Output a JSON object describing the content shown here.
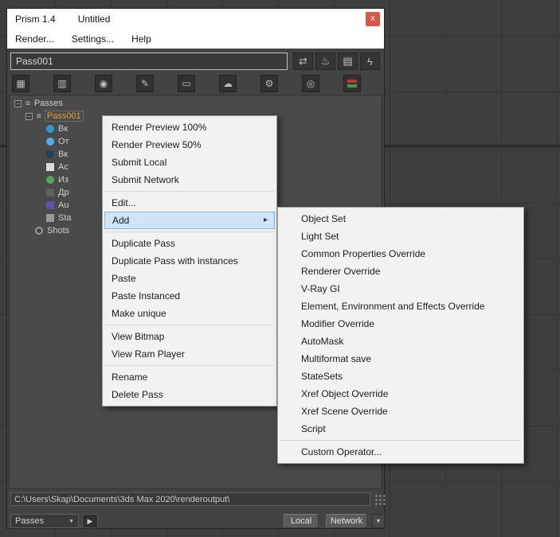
{
  "window": {
    "title": "Prism 1.4",
    "document": "Untitled",
    "close_glyph": "x"
  },
  "menubar": {
    "items": [
      {
        "label": "Render..."
      },
      {
        "label": "Settings..."
      },
      {
        "label": "Help"
      }
    ]
  },
  "pass_field": {
    "value": "Pass001"
  },
  "pass_toolbar": [
    {
      "name": "export-icon",
      "glyph": "⇄"
    },
    {
      "name": "render-teapot-icon",
      "glyph": "♨"
    },
    {
      "name": "render-elements-icon",
      "glyph": "▤"
    },
    {
      "name": "quick-render-icon",
      "glyph": "ϟ"
    }
  ],
  "main_toolbar": [
    {
      "name": "grid-icon",
      "glyph": "▦"
    },
    {
      "name": "display-icon",
      "glyph": "▥"
    },
    {
      "name": "record-icon",
      "glyph": "◉"
    },
    {
      "name": "brush-icon",
      "glyph": "✎"
    },
    {
      "name": "monitor-icon",
      "glyph": "▭"
    },
    {
      "name": "cloud-icon",
      "glyph": "☁"
    },
    {
      "name": "settings-icon",
      "glyph": "⚙"
    },
    {
      "name": "camera-icon",
      "glyph": "◎"
    },
    {
      "name": "colors-icon",
      "glyph": ""
    }
  ],
  "tree": {
    "expander_glyph": "−",
    "root": {
      "label": "Passes",
      "icon_glyph": "≡"
    },
    "selected_pass": {
      "label": "Pass001",
      "icon_glyph": "≡"
    },
    "children": [
      {
        "label": "Вк"
      },
      {
        "label": "От"
      },
      {
        "label": "Вк"
      },
      {
        "label": "Ac"
      },
      {
        "label": "Из"
      },
      {
        "label": "Др"
      },
      {
        "label": "Au"
      },
      {
        "label": "Sta"
      }
    ],
    "shots": {
      "label": "Shots"
    }
  },
  "context_menu": {
    "submenu_arrow": "▸",
    "items": [
      {
        "label": "Render Preview 100%"
      },
      {
        "label": "Render Preview 50%"
      },
      {
        "label": "Submit Local"
      },
      {
        "label": "Submit Network"
      },
      {
        "label": "Edit..."
      },
      {
        "label": "Add"
      },
      {
        "label": "Duplicate Pass"
      },
      {
        "label": "Duplicate Pass with instances"
      },
      {
        "label": "Paste"
      },
      {
        "label": "Paste Instanced"
      },
      {
        "label": "Make unique"
      },
      {
        "label": "View Bitmap"
      },
      {
        "label": "View Ram Player"
      },
      {
        "label": "Rename"
      },
      {
        "label": "Delete Pass"
      }
    ]
  },
  "submenu": {
    "items": [
      {
        "label": "Object Set"
      },
      {
        "label": "Light Set"
      },
      {
        "label": "Common Properties Override"
      },
      {
        "label": "Renderer Override"
      },
      {
        "label": "V-Ray GI"
      },
      {
        "label": "Element, Environment and Effects Override"
      },
      {
        "label": "Modifier Override"
      },
      {
        "label": "AutoMask"
      },
      {
        "label": "Multiformat save"
      },
      {
        "label": "StateSets"
      },
      {
        "label": "Xref Object Override"
      },
      {
        "label": "Xref Scene Override"
      },
      {
        "label": "Script"
      },
      {
        "label": "Custom Operator..."
      }
    ]
  },
  "path_field": {
    "value": "C:\\Users\\Skap\\Documents\\3ds Max 2020\\renderoutput\\"
  },
  "footer": {
    "passes_combo": "Passes",
    "combo_arrow": "▼",
    "play_glyph": "▶",
    "local": "Local",
    "network": "Network",
    "spinner_arrow": "▼"
  },
  "colors": {
    "selection_orange": "#e8a33d",
    "menu_highlight": "#cfe4f7",
    "close_red": "#d8564a"
  }
}
